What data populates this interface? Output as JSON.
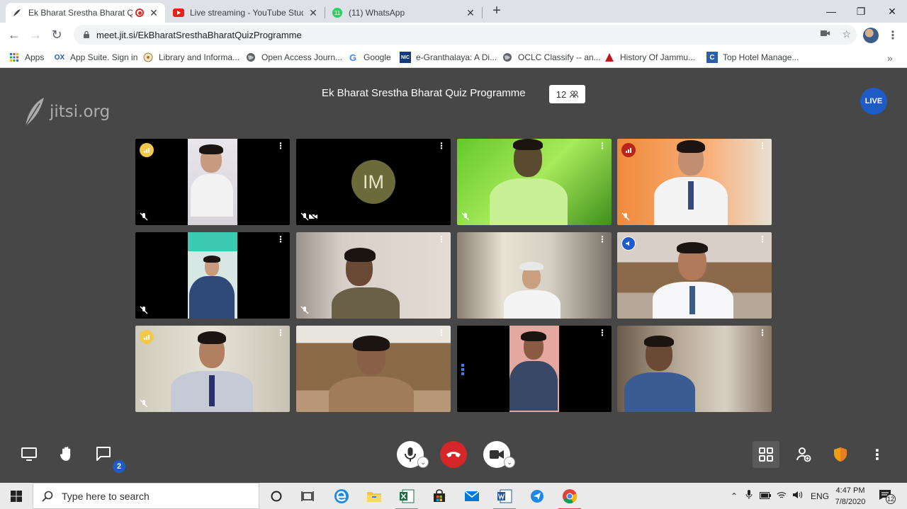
{
  "browser": {
    "tabs": [
      {
        "title": "Ek Bharat Srestha Bharat Qu",
        "active": true,
        "recording": true
      },
      {
        "title": "Live streaming - YouTube Studio",
        "active": false
      },
      {
        "title": "(11) WhatsApp",
        "active": false
      }
    ],
    "url": "meet.jit.si/EkBharatSresthaBharatQuizProgramme",
    "bookmarks": [
      {
        "label": "Apps",
        "icon": "apps-grid-icon"
      },
      {
        "label": "App Suite. Sign in",
        "icon": "ox-icon"
      },
      {
        "label": "Library and Informa...",
        "icon": "library-icon"
      },
      {
        "label": "Open Access Journ...",
        "icon": "globe-icon"
      },
      {
        "label": "Google",
        "icon": "google-icon"
      },
      {
        "label": "e-Granthalaya: A Di...",
        "icon": "nic-icon"
      },
      {
        "label": "OCLC Classify -- an...",
        "icon": "globe-icon"
      },
      {
        "label": "History Of Jammu...",
        "icon": "triangle-icon"
      },
      {
        "label": "Top Hotel Manage...",
        "icon": "c-icon"
      }
    ]
  },
  "meeting": {
    "logo_text": "jitsi.org",
    "title": "Ek Bharat Srestha Bharat Quiz Programme",
    "participant_count": "12",
    "live_label": "LIVE",
    "avatar_initials": "IM",
    "chat_badge": "2"
  },
  "taskbar": {
    "search_placeholder": "Type here to search",
    "language": "ENG",
    "time": "4:47 PM",
    "date": "7/8/2020",
    "notification_count": "12"
  }
}
